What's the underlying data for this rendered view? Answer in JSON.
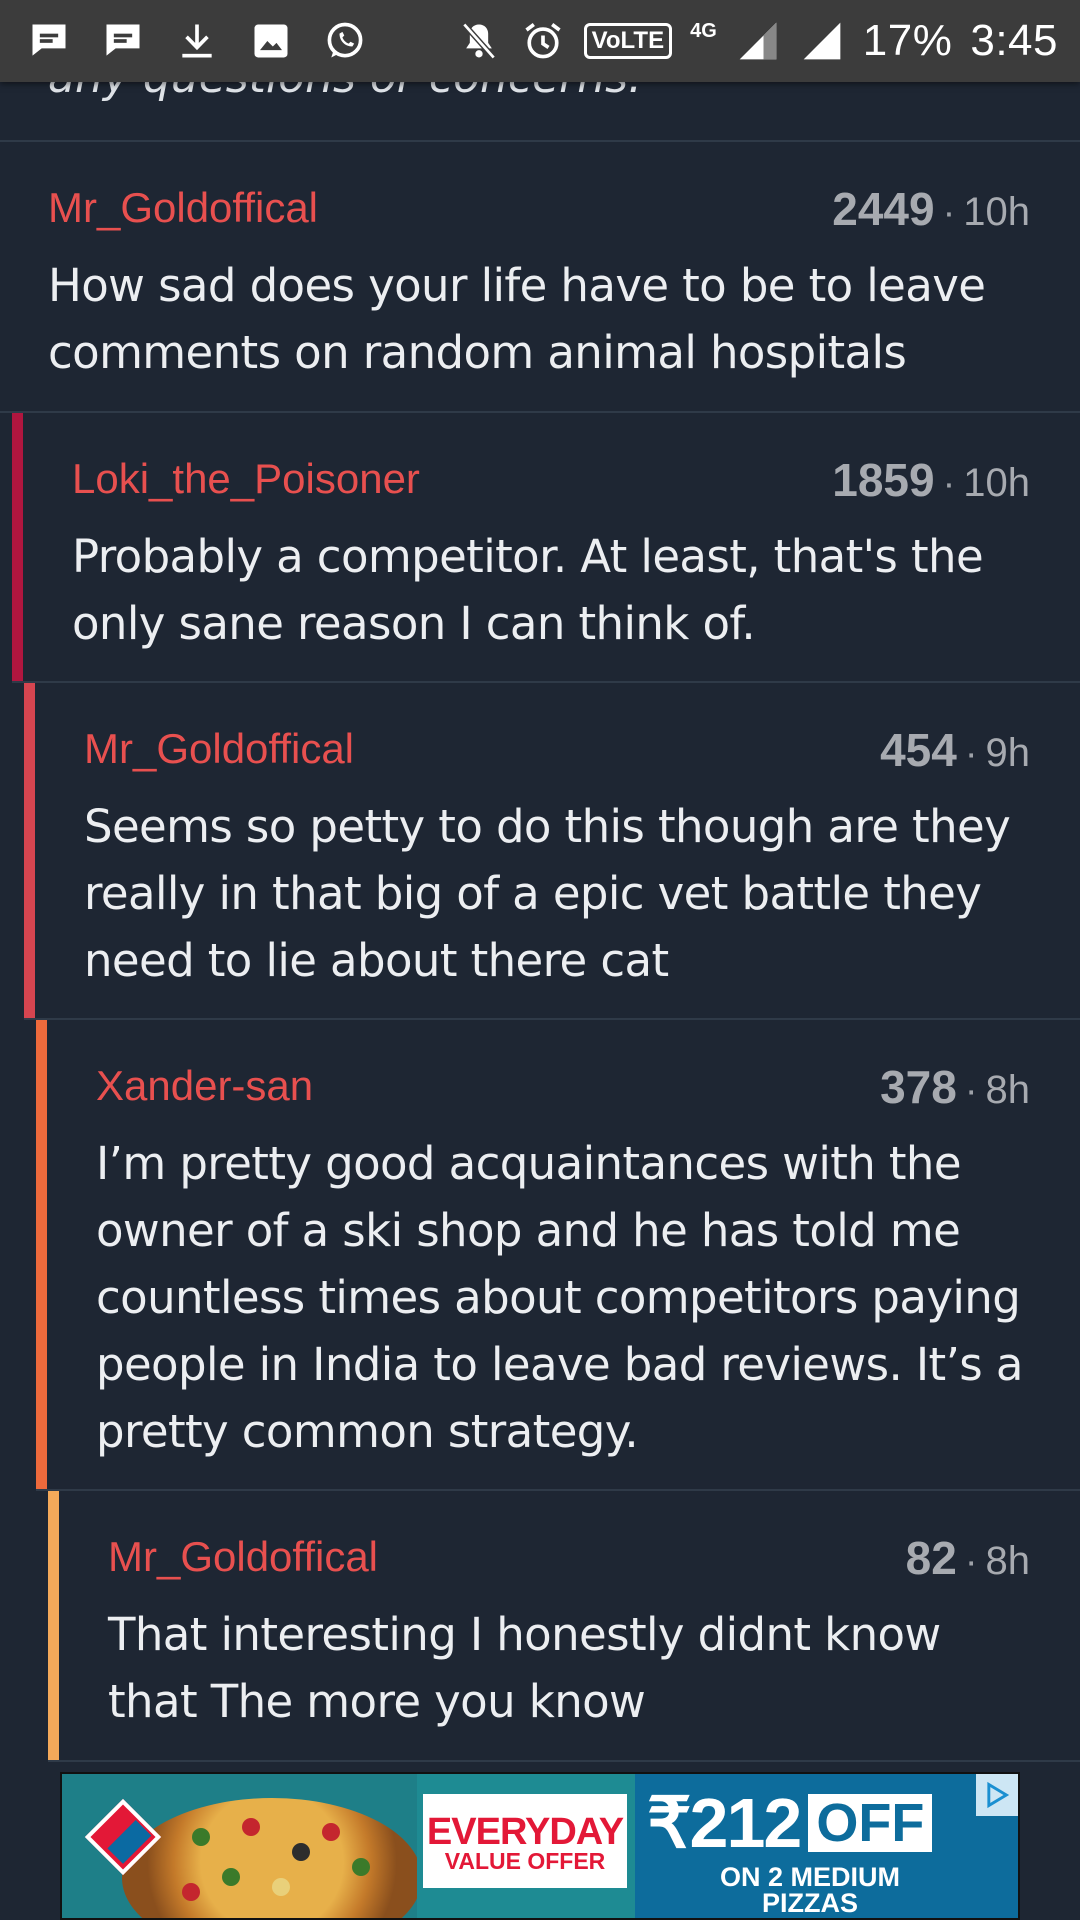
{
  "status_bar": {
    "network": "4G",
    "volte": "VoLTE",
    "battery": "17%",
    "time": "3:45"
  },
  "top_snippet": "any questions or concerns.",
  "comments": [
    {
      "author": "Mr_Goldoffical",
      "score": "2449",
      "time": "10h",
      "body": "How sad does your life have to be to leave comments on random animal hospitals",
      "depth": 0
    },
    {
      "author": "Loki_the_Poisoner",
      "score": "1859",
      "time": "10h",
      "body": "Probably a competitor. At least, that's the only sane reason I can think of.",
      "depth": 1,
      "thread_color": "#b0163f"
    },
    {
      "author": "Mr_Goldoffical",
      "score": "454",
      "time": "9h",
      "body": "Seems so petty to do this though are they really in that big of a epic vet battle they need to lie about there cat",
      "depth": 2,
      "thread_color": "#d64550"
    },
    {
      "author": "Xander-san",
      "score": "378",
      "time": "8h",
      "body": "I’m pretty good acquaintances with the owner of a ski shop and he has told me countless times about competitors paying people in India to leave bad reviews. It’s a pretty common strategy.",
      "depth": 3,
      "thread_color": "#ee6a3c"
    },
    {
      "author": "Mr_Goldoffical",
      "score": "82",
      "time": "8h",
      "body": "That interesting I honestly didnt know that The more you know",
      "depth": 4,
      "thread_color": "#f4a95a"
    }
  ],
  "ad": {
    "headline_1": "EVERYDAY",
    "headline_2": "VALUE OFFER",
    "price": "₹212",
    "off": "OFF",
    "subline": "ON 2 MEDIUM PIZZAS"
  }
}
